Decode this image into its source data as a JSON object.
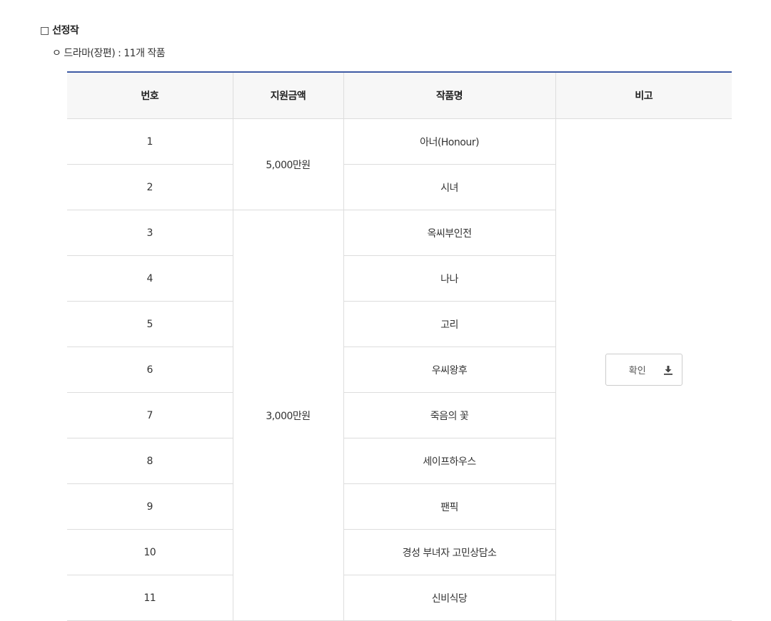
{
  "section": {
    "title": "□ 선정작",
    "subtitle": "ㅇ 드라마(장편) : 11개 작품"
  },
  "table": {
    "headers": [
      "번호",
      "지원금액",
      "작품명",
      "비고"
    ],
    "amounts": [
      "5,000만원",
      "3,000만원"
    ],
    "rows": [
      {
        "no": "1",
        "title": "아너(Honour)"
      },
      {
        "no": "2",
        "title": "시녀"
      },
      {
        "no": "3",
        "title": "옥씨부인전"
      },
      {
        "no": "4",
        "title": "나나"
      },
      {
        "no": "5",
        "title": "고리"
      },
      {
        "no": "6",
        "title": "우씨왕후"
      },
      {
        "no": "7",
        "title": "죽음의 꽃"
      },
      {
        "no": "8",
        "title": "세이프하우스"
      },
      {
        "no": "9",
        "title": "팬픽"
      },
      {
        "no": "10",
        "title": "경성 부녀자 고민상담소"
      },
      {
        "no": "11",
        "title": "신비식당"
      }
    ],
    "note_button": {
      "label": "확인",
      "icon": "download-icon"
    }
  },
  "colors": {
    "accent": "#3d5aa4",
    "header_bg": "#f7f7f7",
    "border": "#dddddd"
  }
}
